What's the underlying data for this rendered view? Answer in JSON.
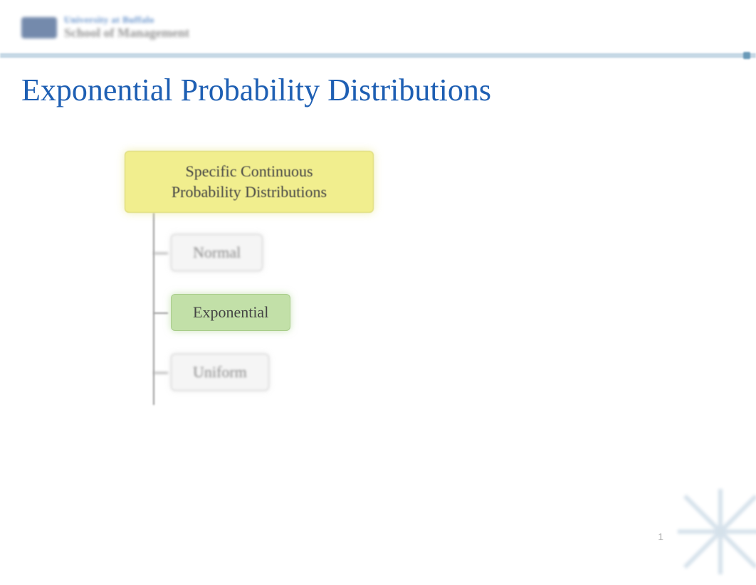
{
  "header": {
    "logo_top": "University at Buffalo",
    "logo_bottom": "School of Management"
  },
  "title": "Exponential Probability Distributions",
  "diagram": {
    "root": "Specific Continuous\nProbability Distributions",
    "children": [
      {
        "label": "Normal",
        "highlighted": false
      },
      {
        "label": "Exponential",
        "highlighted": true
      },
      {
        "label": "Uniform",
        "highlighted": false
      }
    ]
  },
  "page_number": "1"
}
